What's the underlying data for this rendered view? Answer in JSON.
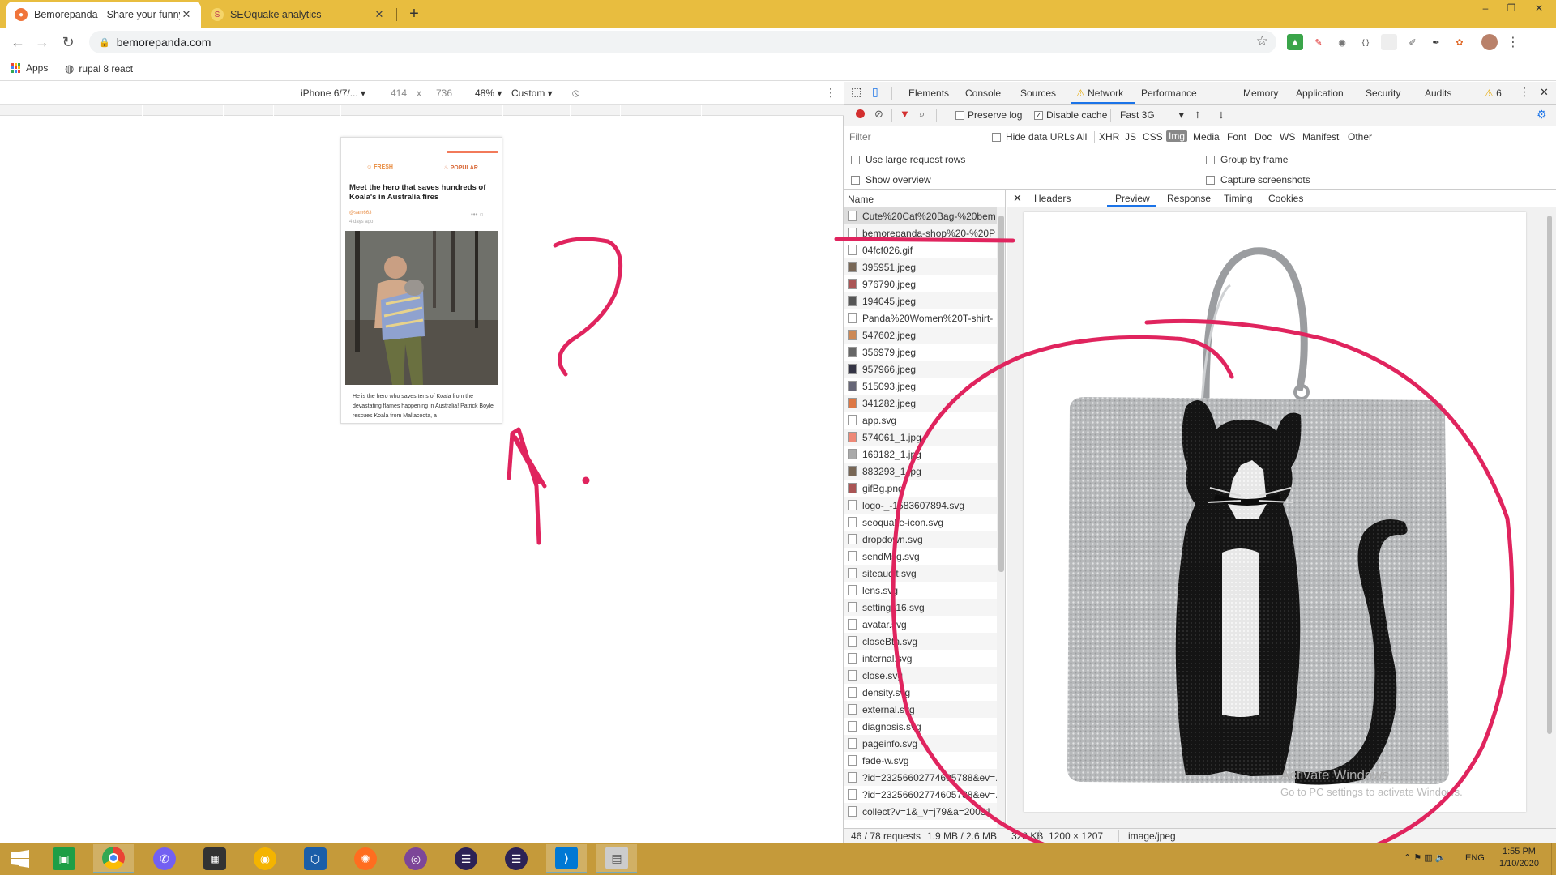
{
  "tabs": [
    {
      "title": "Bemorepanda - Share your funny",
      "icon": "panda-icon",
      "color": "#f0753b"
    },
    {
      "title": "SEOquake analytics",
      "icon": "seoquake-icon",
      "color": "#e8883a"
    }
  ],
  "window_controls": {
    "minimize": "–",
    "restore": "❐",
    "close": "✕"
  },
  "toolbar": {
    "url": "bemorepanda.com"
  },
  "bookmarks": {
    "apps": "Apps",
    "rupal": "rupal 8 react"
  },
  "device_toolbar": {
    "device": "iPhone 6/7/...",
    "width": "414",
    "times": "x",
    "height": "736",
    "zoom": "48%",
    "throttle": "Custom"
  },
  "phone_page": {
    "fresh": "FRESH",
    "popular": "POPULAR",
    "title": "Meet the hero that saves hundreds of Koala's in Australia fires",
    "user": "@sam663",
    "ago": "4 days ago",
    "caption": "He is the hero who saves tens of Koala from the devastating flames happening in Australia! Patrick Boyle rescues Koala from Mallacoota, a"
  },
  "devtools": {
    "tabs": [
      "Elements",
      "Console",
      "Sources",
      "Network",
      "Performance",
      "Memory",
      "Application",
      "Security",
      "Audits"
    ],
    "active_tab": "Network",
    "warnings": "6",
    "preserve_log": "Preserve log",
    "disable_cache": "Disable cache",
    "throttling": "Fast 3G",
    "filter_placeholder": "Filter",
    "hide_data_urls": "Hide data URLs",
    "filter_types": [
      "All",
      "XHR",
      "JS",
      "CSS",
      "Img",
      "Media",
      "Font",
      "Doc",
      "WS",
      "Manifest",
      "Other"
    ],
    "selected_filter": "Img",
    "use_large_rows": "Use large request rows",
    "show_overview": "Show overview",
    "group_by_frame": "Group by frame",
    "capture_screenshots": "Capture screenshots",
    "name_header": "Name",
    "requests": [
      "Cute%20Cat%20Bag-%20bem",
      "bemorepanda-shop%20-%20P",
      "04fcf026.gif",
      "395951.jpeg",
      "976790.jpeg",
      "194045.jpeg",
      "Panda%20Women%20T-shirt-",
      "547602.jpeg",
      "356979.jpeg",
      "957966.jpeg",
      "515093.jpeg",
      "341282.jpeg",
      "app.svg",
      "574061_1.jpg",
      "169182_1.jpg",
      "883293_1.jpg",
      "gifBg.png",
      "logo-_-1583607894.svg",
      "seoquake-icon.svg",
      "dropdown.svg",
      "sendMsg.svg",
      "siteaudit.svg",
      "lens.svg",
      "settings16.svg",
      "avatar.svg",
      "closeBtn.svg",
      "internal.svg",
      "close.svg",
      "density.svg",
      "external.svg",
      "diagnosis.svg",
      "pageinfo.svg",
      "fade-w.svg",
      "?id=23256602774605788&ev=...",
      "?id=23256602774605788&ev=...",
      "collect?v=1&_v=j79&a=20031"
    ],
    "preview_tabs": [
      "Headers",
      "Preview",
      "Response",
      "Timing",
      "Cookies"
    ],
    "active_preview_tab": "Preview",
    "status": {
      "requests": "46 / 78 requests",
      "transferred": "1.9 MB / 2.6 MB",
      "size": "328 KB",
      "dimensions": "1200 × 1207",
      "mime": "image/jpeg"
    }
  },
  "watermark": {
    "line1": "Activate Windows",
    "line2": "Go to PC settings to activate Windows."
  },
  "taskbar": {
    "language": "ENG",
    "time": "1:55 PM",
    "date": "1/10/2020"
  }
}
